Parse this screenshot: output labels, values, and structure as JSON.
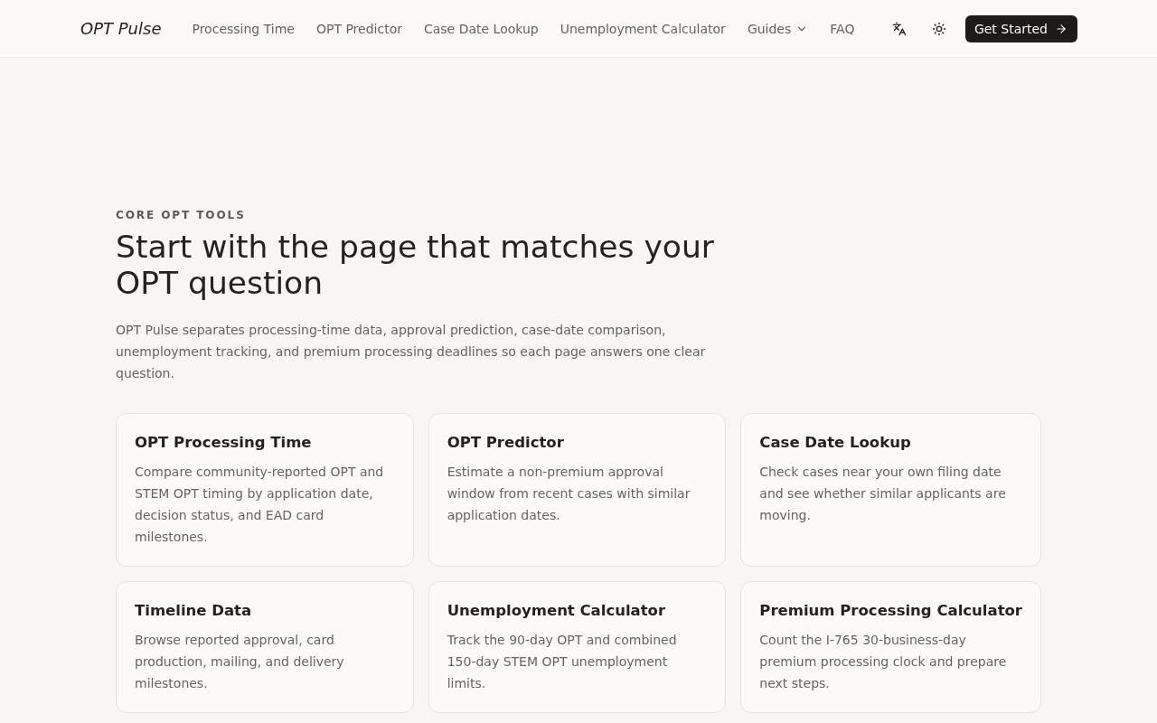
{
  "header": {
    "logo": "OPT Pulse",
    "nav": [
      {
        "label": "Processing Time",
        "kind": "link"
      },
      {
        "label": "OPT Predictor",
        "kind": "link"
      },
      {
        "label": "Case Date Lookup",
        "kind": "link"
      },
      {
        "label": "Unemployment Calculator",
        "kind": "link"
      },
      {
        "label": "Guides",
        "kind": "dropdown"
      },
      {
        "label": "FAQ",
        "kind": "link"
      }
    ],
    "cta": "Get Started"
  },
  "section": {
    "eyebrow": "CORE OPT TOOLS",
    "title": "Start with the page that matches your OPT question",
    "intro": "OPT Pulse separates processing-time data, approval prediction, case-date comparison, unemployment tracking, and premium processing deadlines so each page answers one clear question."
  },
  "cards": [
    {
      "title": "OPT Processing Time",
      "description": "Compare community-reported OPT and STEM OPT timing by application date, decision status, and EAD card milestones."
    },
    {
      "title": "OPT Predictor",
      "description": "Estimate a non-premium approval window from recent cases with similar application dates."
    },
    {
      "title": "Case Date Lookup",
      "description": "Check cases near your own filing date and see whether similar applicants are moving."
    },
    {
      "title": "Timeline Data",
      "description": "Browse reported approval, card production, mailing, and delivery milestones."
    },
    {
      "title": "Unemployment Calculator",
      "description": "Track the 90-day OPT and combined 150-day STEM OPT unemployment limits."
    },
    {
      "title": "Premium Processing Calculator",
      "description": "Count the I-765 30-business-day premium processing clock and prepare next steps."
    }
  ]
}
